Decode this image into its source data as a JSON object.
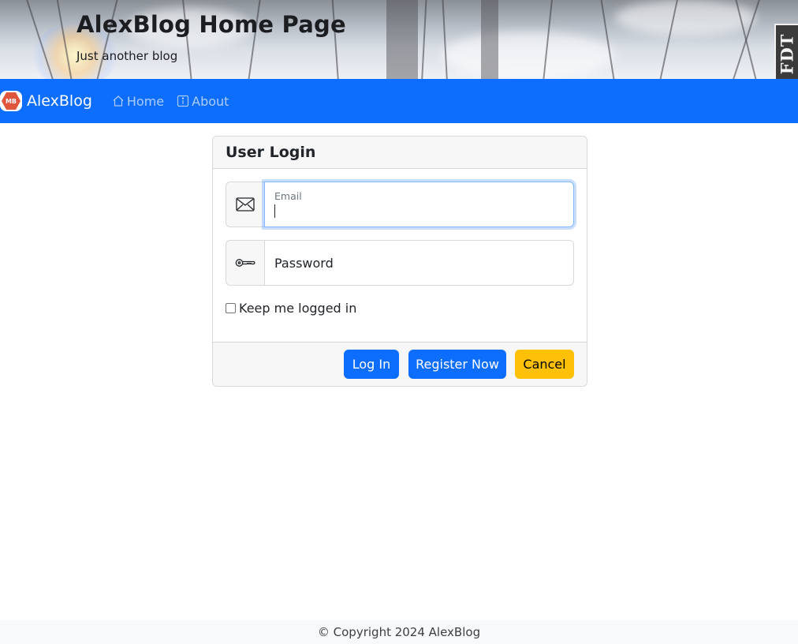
{
  "header": {
    "title": "AlexBlog Home Page",
    "subtitle": "Just another blog",
    "debug_tab": "FDT"
  },
  "navbar": {
    "brand_logo_text": "MB",
    "brand_name": "AlexBlog",
    "items": [
      {
        "label": "Home",
        "icon": "house-icon"
      },
      {
        "label": "About",
        "icon": "info-square-icon"
      }
    ],
    "background": "#0d6efd"
  },
  "login_card": {
    "title": "User Login",
    "email": {
      "label": "Email",
      "value": "",
      "icon": "envelope-icon",
      "focused": true
    },
    "password": {
      "placeholder": "Password",
      "value": "",
      "icon": "key-icon"
    },
    "remember_me": {
      "label": "Keep me logged in",
      "checked": false
    },
    "buttons": {
      "login": "Log In",
      "register": "Register Now",
      "cancel": "Cancel"
    },
    "colors": {
      "primary": "#0d6efd",
      "warning": "#ffc107"
    }
  },
  "footer": {
    "copyright": "© Copyright 2024 AlexBlog"
  }
}
